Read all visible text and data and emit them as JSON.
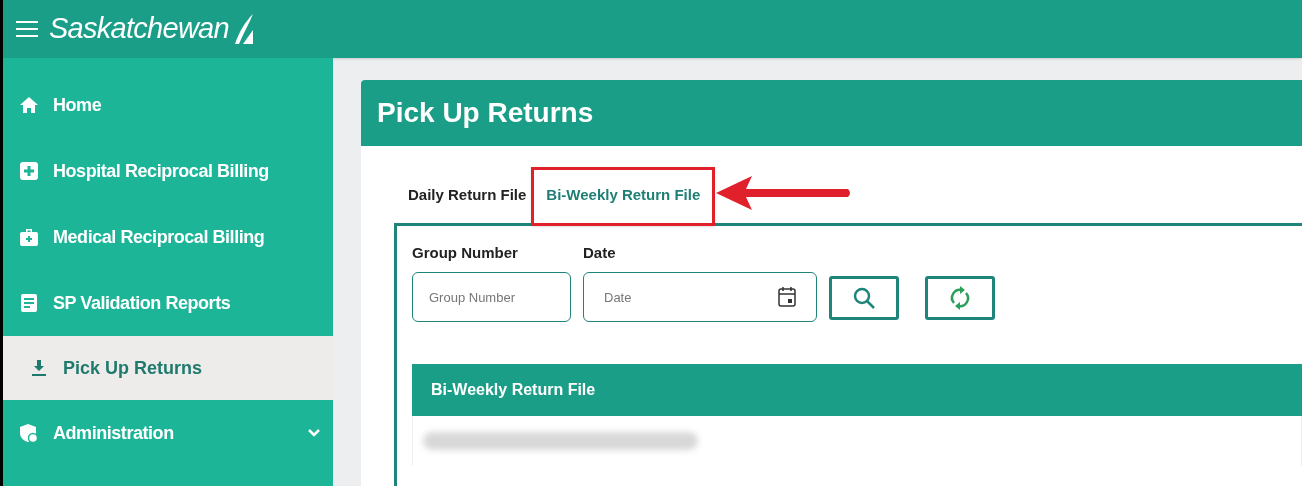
{
  "header": {
    "logo_text": "Saskatchewan"
  },
  "sidebar": {
    "items": [
      {
        "label": "Home",
        "kind": "home",
        "selected": false
      },
      {
        "label": "Hospital Reciprocal Billing",
        "kind": "plus",
        "selected": false
      },
      {
        "label": "Medical Reciprocal Billing",
        "kind": "kit",
        "selected": false
      },
      {
        "label": "SP Validation Reports",
        "kind": "doc",
        "selected": false
      },
      {
        "label": "Pick Up Returns",
        "kind": "download",
        "selected": true
      },
      {
        "label": "Administration",
        "kind": "shield",
        "selected": false,
        "expandable": true
      }
    ]
  },
  "page": {
    "title": "Pick Up Returns",
    "tabs": [
      {
        "label": "Daily Return File",
        "selected": false,
        "highlighted": false
      },
      {
        "label": "Bi-Weekly Return File",
        "selected": true,
        "highlighted": true
      }
    ],
    "fields": [
      {
        "label": "Group Number",
        "placeholder": "Group Number",
        "kind": "text"
      },
      {
        "label": "Date",
        "placeholder": "Date",
        "kind": "date"
      }
    ],
    "buttons": [
      {
        "kind": "search"
      },
      {
        "kind": "refresh"
      }
    ],
    "table": {
      "title": "Bi-Weekly Return File",
      "rows": [
        {
          "kind": "redacted"
        }
      ]
    }
  }
}
